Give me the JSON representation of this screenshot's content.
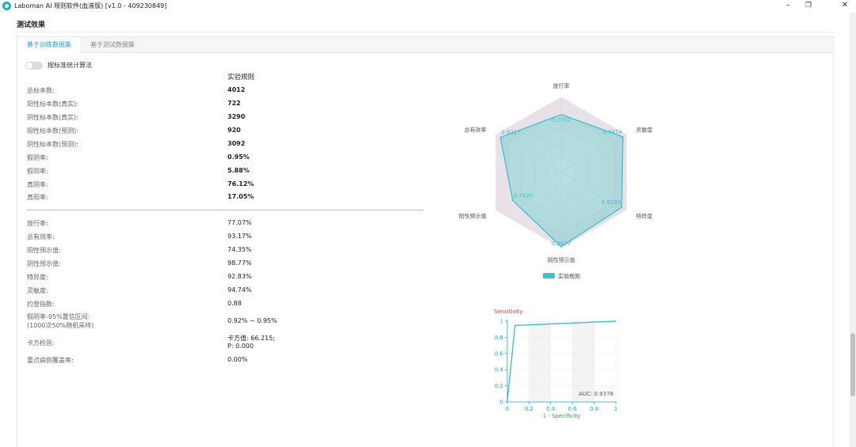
{
  "window": {
    "title": "Laboman AI 规则软件(血液版) [v1.0 - 409230849]",
    "minimize": "–",
    "restore": "❐",
    "close": "✕"
  },
  "section": {
    "title": "测试效果"
  },
  "tabs": [
    {
      "label": "基于训练数据集",
      "active": true
    },
    {
      "label": "基于测试数据集",
      "active": false
    }
  ],
  "toggle": {
    "label": "按标准统计算法",
    "on": false
  },
  "table": {
    "column_header": "实验规则",
    "counts": [
      {
        "label": "总标本数:",
        "value": "4012"
      },
      {
        "label": "阳性标本数(真实):",
        "value": "722"
      },
      {
        "label": "阴性标本数(真实):",
        "value": "3290"
      },
      {
        "label": "阳性标本数(预测):",
        "value": "920"
      },
      {
        "label": "阴性标本数(预测):",
        "value": "3092"
      },
      {
        "label": "假阴率:",
        "value": "0.95%"
      },
      {
        "label": "假阳率:",
        "value": "5.88%"
      },
      {
        "label": "真阴率:",
        "value": "76.12%"
      },
      {
        "label": "真阳率:",
        "value": "17.05%"
      }
    ],
    "metrics": [
      {
        "label": "放行率:",
        "value": "77.07%"
      },
      {
        "label": "总有效率:",
        "value": "93.17%"
      },
      {
        "label": "阳性预示值:",
        "value": "74.35%"
      },
      {
        "label": "阴性预示值:",
        "value": "98.77%"
      },
      {
        "label": "特异度:",
        "value": "92.83%"
      },
      {
        "label": "灵敏度:",
        "value": "94.74%"
      },
      {
        "label": "约登指数:",
        "value": "0.88"
      }
    ],
    "ci": {
      "label_line1": "假阴率-95%置信区间:",
      "label_line2": "(1000次50%随机采样)",
      "value": "0.92% ~ 0.95%"
    },
    "chi": {
      "label": "卡方检验:",
      "value_line1": "卡方值: 66.215;",
      "value_line2": "P: 0.000"
    },
    "coverage": {
      "label": "重点病例覆盖率:",
      "value": "0.00%"
    }
  },
  "chart_data": [
    {
      "type": "radar",
      "axes": [
        "放行率",
        "灵敏度",
        "特异度",
        "阴性预示值",
        "阳性预示值",
        "总有效率"
      ],
      "series": [
        {
          "name": "实验规则",
          "values": [
            0.7707,
            0.9474,
            0.9283,
            0.9877,
            0.7435,
            0.9317
          ]
        }
      ],
      "value_labels": [
        "0.7707",
        "0.9474",
        "0.9283",
        "0.9877",
        "0.7435",
        "0.9317"
      ],
      "max": 1,
      "legend": {
        "label": "实验规则",
        "placement": "bottom"
      },
      "colors": {
        "series": "#3cc3c9",
        "fill": "#7fcfcf",
        "web": "#e4dde4"
      }
    },
    {
      "type": "line",
      "ylabel": "Sensitivity",
      "xlabel": "1 - Specificity",
      "x": [
        0,
        0.0717,
        1
      ],
      "y": [
        0,
        0.9474,
        1
      ],
      "xlim": [
        0,
        1
      ],
      "ylim": [
        0,
        1
      ],
      "xticks": [
        "0",
        "0.2",
        "0.4",
        "0.6",
        "0.8",
        "1"
      ],
      "yticks": [
        "0",
        "0.2",
        "0.4",
        "0.6",
        "0.8",
        "1"
      ],
      "annotation": "AUC: 0.9378",
      "grid": true,
      "colors": {
        "line": "#3cc3c9",
        "ylabel": "#e03a3a",
        "xlabel": "#3aa63a",
        "axis": "#1aa7d8"
      }
    }
  ]
}
